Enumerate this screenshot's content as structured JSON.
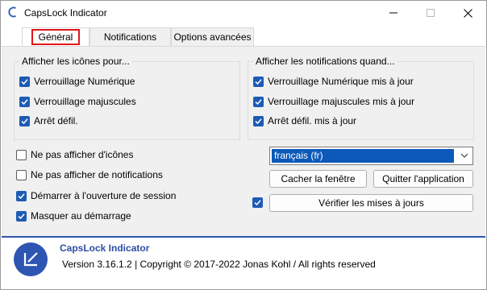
{
  "window": {
    "title": "CapsLock Indicator",
    "controls": {
      "minimize": "minimize-icon",
      "maximize": "maximize-icon",
      "close": "close-icon"
    }
  },
  "tabs": [
    {
      "label": "Général",
      "active": true
    },
    {
      "label": "Notifications",
      "active": false
    },
    {
      "label": "Options avancées",
      "active": false
    }
  ],
  "icons_group": {
    "title": "Afficher les icônes pour...",
    "items": [
      {
        "label": "Verrouillage Numérique",
        "checked": true
      },
      {
        "label": "Verrouillage majuscules",
        "checked": true
      },
      {
        "label": "Arrêt défil.",
        "checked": true
      }
    ]
  },
  "notifications_group": {
    "title": "Afficher les notifications quand...",
    "items": [
      {
        "label": "Verrouillage Numérique mis à jour",
        "checked": true
      },
      {
        "label": "Verrouillage majuscules mis à jour",
        "checked": true
      },
      {
        "label": "Arrêt défil. mis à jour",
        "checked": true
      }
    ]
  },
  "options": [
    {
      "label": "Ne pas afficher d'icônes",
      "checked": false
    },
    {
      "label": "Ne pas afficher de notifications",
      "checked": false
    },
    {
      "label": "Démarrer à l'ouverture de session",
      "checked": true
    },
    {
      "label": "Masquer au démarrage",
      "checked": true
    }
  ],
  "language_select": {
    "value": "français (fr)"
  },
  "buttons": {
    "hide_window": "Cacher la fenêtre",
    "quit_app": "Quitter l'application",
    "check_updates": "Vérifier les mises à jours",
    "auto_update_checked": true
  },
  "footer": {
    "app_name": "CapsLock Indicator",
    "version_line": "Version 3.16.1.2 | Copyright © 2017-2022 Jonas Kohl / All rights reserved"
  },
  "colors": {
    "accent": "#1d5bb5",
    "tab_highlight": "#e0161b",
    "footer_title": "#2c4ea3",
    "logo_bg": "#2f55b3"
  }
}
